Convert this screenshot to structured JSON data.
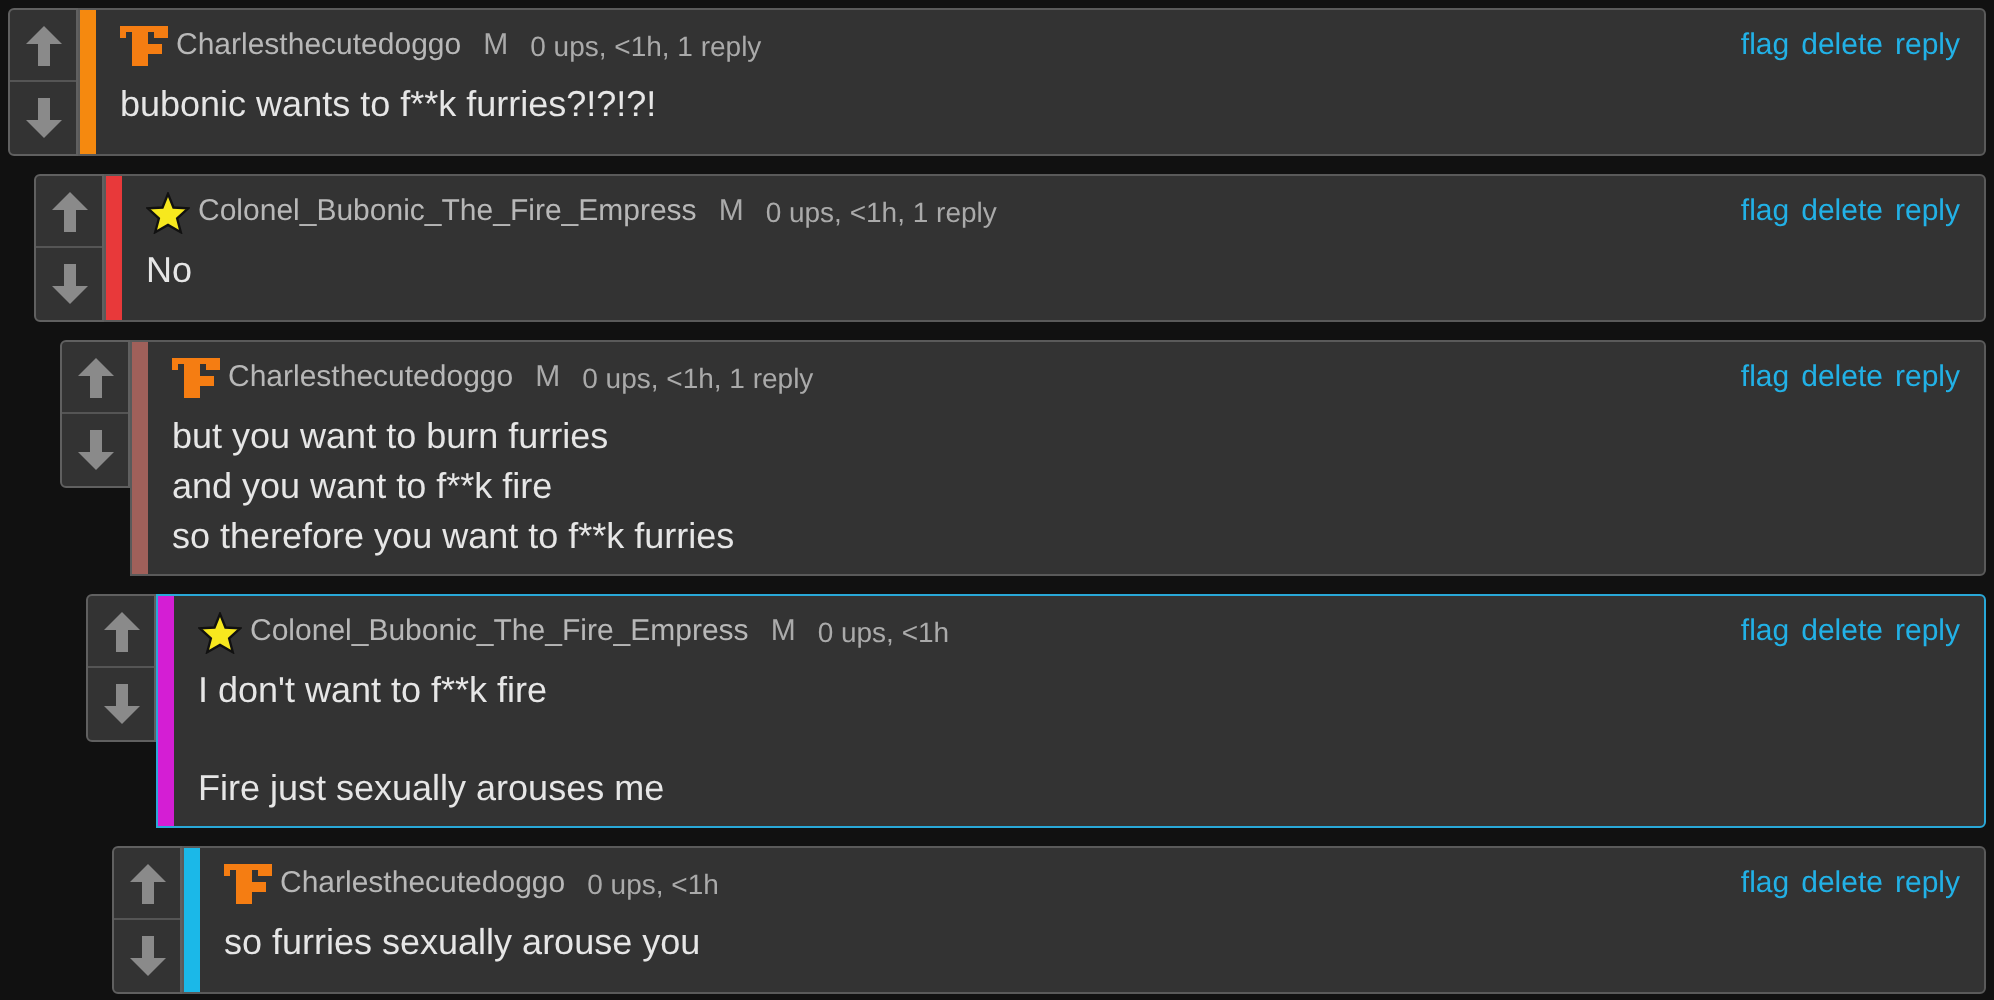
{
  "thread": {
    "author": "Charlesthecutedoggo",
    "kind": "logo",
    "gender": "M",
    "meta": "0 ups, <1h, 1 reply",
    "color": "#f5890f",
    "highlighted": false,
    "actions": [
      "flag",
      "delete",
      "reply"
    ],
    "paragraphs": [
      "bubonic wants to f**k furries?!?!?!"
    ],
    "replies": [
      {
        "author": "Colonel_Bubonic_The_Fire_Empress",
        "kind": "star",
        "gender": "M",
        "meta": "0 ups, <1h, 1 reply",
        "color": "#e8393a",
        "highlighted": false,
        "actions": [
          "flag",
          "delete",
          "reply"
        ],
        "paragraphs": [
          "No"
        ],
        "replies": [
          {
            "author": "Charlesthecutedoggo",
            "kind": "logo",
            "gender": "M",
            "meta": "0 ups, <1h, 1 reply",
            "color": "#a0605a",
            "highlighted": false,
            "actions": [
              "flag",
              "delete",
              "reply"
            ],
            "paragraphs": [
              "but you want to burn furries\nand you want to f**k fire\nso therefore you want to f**k furries"
            ],
            "replies": [
              {
                "author": "Colonel_Bubonic_The_Fire_Empress",
                "kind": "star",
                "gender": "M",
                "meta": "0 ups, <1h",
                "color": "#d41ed4",
                "highlighted": true,
                "actions": [
                  "flag",
                  "delete",
                  "reply"
                ],
                "paragraphs": [
                  "I don't want to f**k fire",
                  "Fire just sexually arouses me"
                ],
                "replies": [
                  {
                    "author": "Charlesthecutedoggo",
                    "kind": "logo",
                    "meta": "0 ups, <1h",
                    "color": "#1bb8e8",
                    "highlighted": false,
                    "actions": [
                      "flag",
                      "delete",
                      "reply"
                    ],
                    "paragraphs": [
                      "so furries sexually arouse you"
                    ]
                  }
                ]
              }
            ]
          }
        ]
      }
    ]
  }
}
